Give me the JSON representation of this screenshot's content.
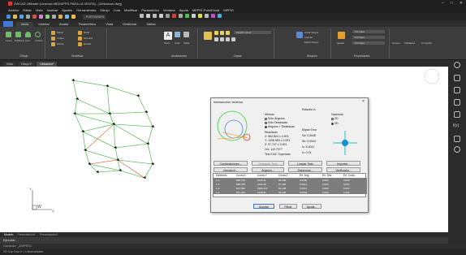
{
  "titlebar": {
    "title": "ZWCAD Ultimate (Licencia MEDAPPS PARA LA VENTA) - [Ubicacion.dwg]"
  },
  "menubar": {
    "items": [
      "Archivo",
      "Editar",
      "Vista",
      "Insertar",
      "Ajustes",
      "Herramientas",
      "Dibujo",
      "Cota",
      "Modificar",
      "Paramétrico",
      "Ventana",
      "Ayuda",
      "MEPIS-PointCloud",
      "MEPIS"
    ]
  },
  "quickbar": {
    "layer_name": "PORTIONER1"
  },
  "tabs": [
    "Inicio",
    "Insertar",
    "Anotar",
    "Paramétrico",
    "Vista",
    "Gestionar",
    "Salida"
  ],
  "ribbon": {
    "groups": [
      "Dibujo",
      "Modificar",
      "Anotaciones",
      "Capas",
      "Bloques",
      "Propiedades"
    ],
    "draw_tools": [
      "Línea",
      "Polilínea",
      "Arco",
      "Círculo"
    ],
    "modify_tools": [
      "Mover",
      "Rotar",
      "Copiar",
      "Simetría",
      "Estirar",
      "Escala"
    ],
    "annotate": [
      "Texto",
      "Cota",
      "Tabla"
    ],
    "layer_name": "Estado actual",
    "block_tools": [
      "Crear bloque",
      "Insertar",
      "Editar bloque"
    ],
    "prop_values": [
      "PorCapa",
      "PorCapa",
      "PorCapa"
    ],
    "extra": [
      "Grupos",
      "Utilidades",
      "Compartir"
    ],
    "match": "Igualar"
  },
  "filetabs": [
    "Inicio",
    "Dibujo1*",
    "Ubicacion*"
  ],
  "layouttabs": [
    "Modelo",
    "Presentación1",
    "Presentación2"
  ],
  "cmdline": {
    "text": "Ejecutar:"
  },
  "cmdhist": {
    "text": "Comando: _ZWIPROC"
  },
  "statusbar": {
    "text": "2D Sup Cota  0 > s.Normalizado"
  },
  "dialog": {
    "title": "Intersección Inversa",
    "method_label": "Método",
    "methods": [
      "Sólo Ángulos",
      "Sólo Distancias",
      "Ángulos + Distancias"
    ],
    "station_label": "Estación A",
    "options_label": "Opciones",
    "options": [
      "2D",
      "3D"
    ],
    "result_label": "Resultado",
    "results": [
      "X: 562,824 ± 0.001",
      "Y: 1008.953 ± 0.001",
      "Z: 97.747 ± 0.001",
      "Chi: 142.7077",
      "Test Chi2: Superado"
    ],
    "ellipse_label": "Elipse Error",
    "ellipse": [
      "Sa: 0.0048",
      "Sb: 0.0044",
      "Ic: 8.3011",
      "Ic: 0.01"
    ],
    "buttons_row1": [
      "Combinaciones...",
      "Deshacer Todo",
      "Limpiar Todo",
      "Importar..."
    ],
    "buttons_row2": [
      "Introducir...",
      "Ángulos...",
      "Distancias...",
      "Verificador..."
    ],
    "table_headers": [
      "Elemento",
      "Coord.X",
      "Coord.Y",
      "Coord.Z",
      "Err. Ang.",
      "Err. Dist",
      "Err. Coda"
    ],
    "table_rows": [
      [
        "1-1",
        "596.715",
        "1016.11",
        "98.480",
        "0.0000",
        "0.000",
        "0.009"
      ],
      [
        "1-2",
        "598.708",
        "1021.60",
        "97.950",
        "0.0014",
        "0.000",
        "0.004"
      ],
      [
        "1-3",
        "601.406",
        "1009.447",
        "96.448",
        "0.0014",
        "0.000",
        "0.002"
      ],
      [
        "1-4",
        "567.405",
        "1028.81",
        "98.448",
        "0.0002",
        "0.000",
        "0.002"
      ]
    ],
    "bottom_buttons": [
      "Aceptar",
      "Filtrar",
      "Ayuda..."
    ]
  }
}
